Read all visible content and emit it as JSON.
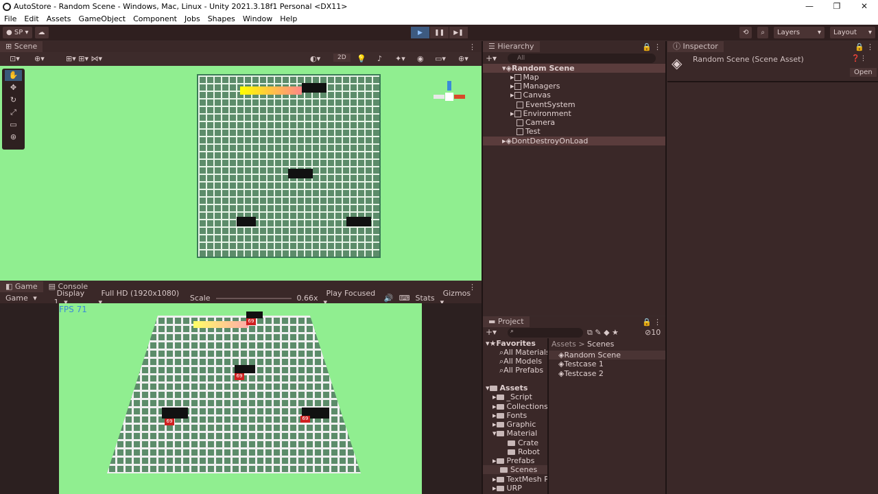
{
  "window": {
    "title": "AutoStore - Random Scene - Windows, Mac, Linux - Unity 2021.3.18f1 Personal <DX11>",
    "controls": [
      "—",
      "❐",
      "✕"
    ]
  },
  "menu": [
    "File",
    "Edit",
    "Assets",
    "GameObject",
    "Component",
    "Jobs",
    "Shapes",
    "Window",
    "Help"
  ],
  "toolbar": {
    "account": "SP",
    "layers": "Layers",
    "layout": "Layout"
  },
  "scene": {
    "tab": "Scene",
    "mode_2d": "2D"
  },
  "game": {
    "tab_game": "Game",
    "tab_console": "Console",
    "view": "Game",
    "display": "Display 1",
    "resolution": "Full HD (1920x1080)",
    "scale_label": "Scale",
    "scale_value": "0.66x",
    "play_mode": "Play Focused",
    "stats": "Stats",
    "gizmos": "Gizmos",
    "fps": "FPS 71",
    "badges": [
      "69",
      "69",
      "69",
      "69"
    ]
  },
  "hierarchy": {
    "tab": "Hierarchy",
    "search_placeholder": "All",
    "root": "Random Scene",
    "children": [
      "Map",
      "Managers",
      "Canvas",
      "EventSystem",
      "Environment",
      "Camera",
      "Test"
    ],
    "dontdestroy": "DontDestroyOnLoad"
  },
  "inspector": {
    "tab": "Inspector",
    "title": "Random Scene (Scene Asset)",
    "open": "Open"
  },
  "project": {
    "tab": "Project",
    "hidden_count": "10",
    "favorites": "Favorites",
    "fav_items": [
      "All Materials",
      "All Models",
      "All Prefabs"
    ],
    "assets_label": "Assets",
    "asset_folders": [
      "_Script",
      "Collections",
      "Fonts",
      "Graphic",
      "Material",
      "Crate",
      "Robot",
      "Prefabs",
      "Scenes",
      "TextMesh P",
      "URP"
    ],
    "breadcrumb": [
      "Assets",
      ">",
      "Scenes"
    ],
    "scene_files": [
      "Random Scene",
      "Testcase 1",
      "Testcase 2"
    ]
  }
}
